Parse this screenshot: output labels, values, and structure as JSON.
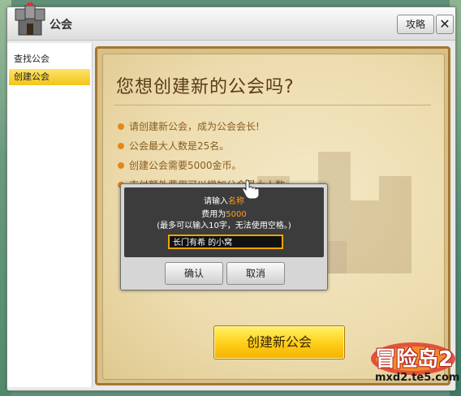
{
  "window": {
    "title": "公会",
    "strategy_button": "攻略",
    "close_symbol": "✕"
  },
  "sidebar": {
    "items": [
      {
        "label": "查找公会",
        "active": false
      },
      {
        "label": "创建公会",
        "active": true
      }
    ]
  },
  "main": {
    "heading": "您想创建新的公会吗?",
    "bullets": [
      "请创建新公会，成为公会会长!",
      "公会最大人数是25名。",
      "创建公会需要5000金币。",
      "支付额外费用可以增加公会最大人数。"
    ],
    "create_button": "创建新公会"
  },
  "dialog": {
    "line1_prefix": "请输入",
    "line1_highlight": "名称",
    "line2_prefix": "费用为",
    "line2_highlight": "5000",
    "hint": "(最多可以输入10字，无法使用空格。)",
    "input_value": "长门有希 的小窝",
    "confirm": "确认",
    "cancel": "取消"
  },
  "branding": {
    "logo_text": "冒险岛2",
    "url": "mxd2.te5.com"
  },
  "colors": {
    "accent": "#ffd11d",
    "highlight": "#ff9e1b",
    "heading": "#5a3a1a",
    "bullet_text": "#8a5d1f"
  }
}
